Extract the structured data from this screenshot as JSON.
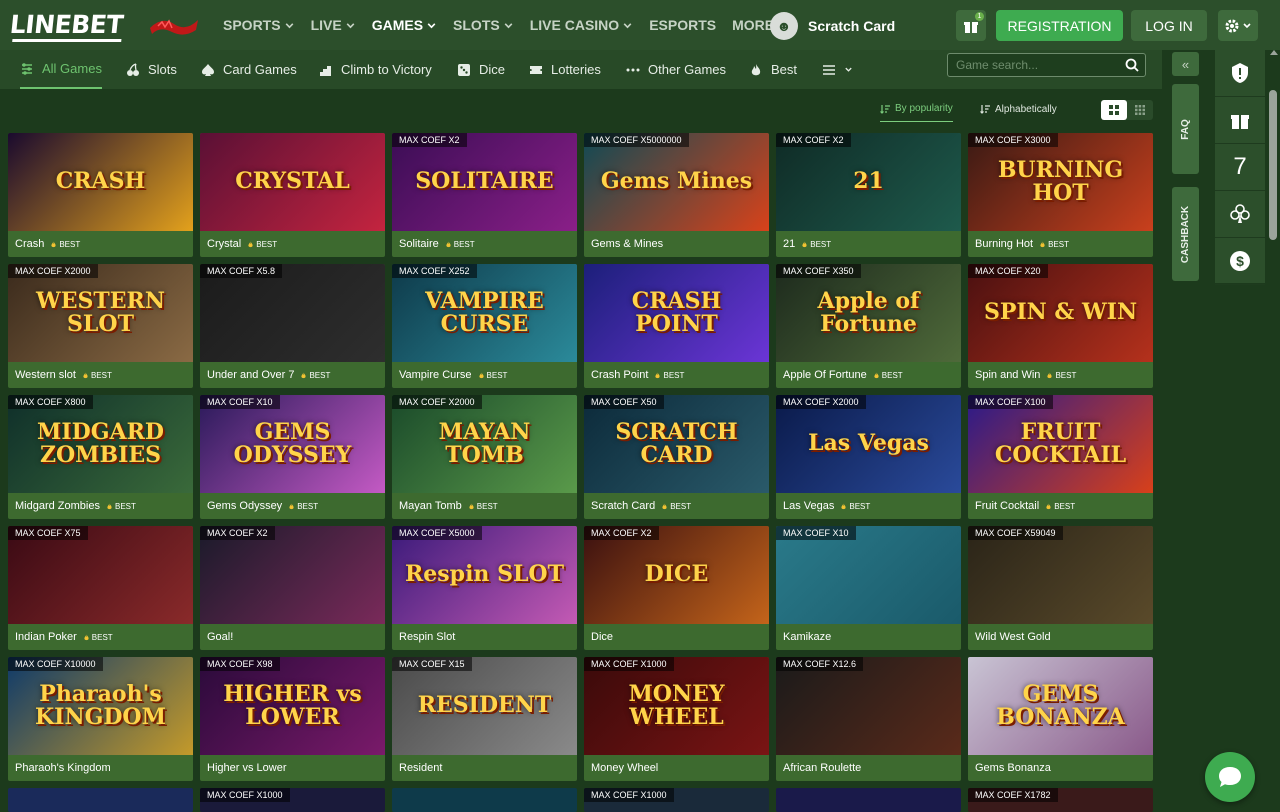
{
  "logo": "LINEBET",
  "nav": [
    {
      "label": "SPORTS",
      "chevron": true,
      "active": false
    },
    {
      "label": "LIVE",
      "chevron": true,
      "active": false
    },
    {
      "label": "GAMES",
      "chevron": true,
      "active": true
    },
    {
      "label": "SLOTS",
      "chevron": true,
      "active": false
    },
    {
      "label": "LIVE CASINO",
      "chevron": true,
      "active": false
    },
    {
      "label": "ESPORTS",
      "chevron": false,
      "active": false
    },
    {
      "label": "MORE",
      "chevron": true,
      "active": false
    }
  ],
  "scratch_card": "Scratch Card",
  "gift_badge": "1",
  "registration": "REGISTRATION",
  "login": "LOG IN",
  "categories": [
    {
      "label": "All Games",
      "icon": "sliders-icon",
      "active": true
    },
    {
      "label": "Slots",
      "icon": "cherries-icon",
      "active": false
    },
    {
      "label": "Card Games",
      "icon": "spade-icon",
      "active": false
    },
    {
      "label": "Climb to Victory",
      "icon": "chart-steps-icon",
      "active": false
    },
    {
      "label": "Dice",
      "icon": "dice-icon",
      "active": false
    },
    {
      "label": "Lotteries",
      "icon": "ticket-icon",
      "active": false
    },
    {
      "label": "Other Games",
      "icon": "dots-icon",
      "active": false
    },
    {
      "label": "Best",
      "icon": "flame-icon",
      "active": false
    }
  ],
  "search_placeholder": "Game search...",
  "sort": {
    "popularity": "By popularity",
    "alphabetical": "Alphabetically"
  },
  "side_tabs": {
    "faq": "FAQ",
    "cashback": "CASHBACK"
  },
  "side_number": "7",
  "best_label": "BEST",
  "games": [
    {
      "name": "Crash",
      "badge": "",
      "best": true,
      "art": "CRASH",
      "bg": [
        "#1a0a2e",
        "#e3a11c"
      ]
    },
    {
      "name": "Crystal",
      "badge": "",
      "best": true,
      "art": "CRYSTAL",
      "bg": [
        "#5a1035",
        "#c4243f"
      ]
    },
    {
      "name": "Solitaire",
      "badge": "MAX COEF X2",
      "best": true,
      "art": "SOLITAIRE",
      "bg": [
        "#3b0d55",
        "#8a1f88"
      ]
    },
    {
      "name": "Gems & Mines",
      "badge": "MAX COEF X5000000",
      "best": false,
      "art": "Gems Mines",
      "bg": [
        "#0f4a55",
        "#d8421a"
      ]
    },
    {
      "name": "21",
      "badge": "MAX COEF X2",
      "best": true,
      "art": "21",
      "bg": [
        "#0f2b26",
        "#1e5a4c"
      ]
    },
    {
      "name": "Burning Hot",
      "badge": "MAX COEF X3000",
      "best": true,
      "art": "BURNING HOT",
      "bg": [
        "#3a1a14",
        "#c9401d"
      ]
    },
    {
      "name": "Western slot",
      "badge": "MAX COEF X2000",
      "best": true,
      "art": "WESTERN SLOT",
      "bg": [
        "#3a2a1c",
        "#8a6a44"
      ]
    },
    {
      "name": "Under and Over 7",
      "badge": "MAX COEF X5.8",
      "best": true,
      "art": "",
      "bg": [
        "#1b1b1b",
        "#2e2e2e"
      ]
    },
    {
      "name": "Vampire Curse",
      "badge": "MAX COEF X252",
      "best": true,
      "art": "VAMPIRE CURSE",
      "bg": [
        "#0e3a4a",
        "#2b8a9a"
      ]
    },
    {
      "name": "Crash Point",
      "badge": "",
      "best": true,
      "art": "CRASH POINT",
      "bg": [
        "#1c1f7a",
        "#6b35d6"
      ]
    },
    {
      "name": "Apple Of Fortune",
      "badge": "MAX COEF X350",
      "best": true,
      "art": "Apple of Fortune",
      "bg": [
        "#1d2a1d",
        "#4f6a3a"
      ]
    },
    {
      "name": "Spin and Win",
      "badge": "MAX COEF X20",
      "best": true,
      "art": "SPIN & WIN",
      "bg": [
        "#4a1010",
        "#b5311c"
      ]
    },
    {
      "name": "Midgard Zombies",
      "badge": "MAX COEF X800",
      "best": true,
      "art": "MIDGARD ZOMBIES",
      "bg": [
        "#0f2f2a",
        "#3a6a3a"
      ]
    },
    {
      "name": "Gems Odyssey",
      "badge": "MAX COEF X10",
      "best": true,
      "art": "GEMS ODYSSEY",
      "bg": [
        "#2a1a5a",
        "#c45ac4"
      ]
    },
    {
      "name": "Mayan Tomb",
      "badge": "MAX COEF X2000",
      "best": true,
      "art": "MAYAN TOMB",
      "bg": [
        "#1a4a2a",
        "#5a9a4a"
      ]
    },
    {
      "name": "Scratch Card",
      "badge": "MAX COEF X50",
      "best": true,
      "art": "SCRATCH CARD",
      "bg": [
        "#0c2a3a",
        "#2a5a6a"
      ]
    },
    {
      "name": "Las Vegas",
      "badge": "MAX COEF X2000",
      "best": true,
      "art": "Las Vegas",
      "bg": [
        "#0a1a4a",
        "#2a4a9a"
      ]
    },
    {
      "name": "Fruit Cocktail",
      "badge": "MAX COEF X100",
      "best": true,
      "art": "FRUIT COCKTAIL",
      "bg": [
        "#2a1a8a",
        "#d8401a"
      ]
    },
    {
      "name": "Indian Poker",
      "badge": "MAX COEF X75",
      "best": true,
      "art": "",
      "bg": [
        "#3a0a14",
        "#8a2a2a"
      ]
    },
    {
      "name": "Goal!",
      "badge": "MAX COEF X2",
      "best": false,
      "art": "",
      "bg": [
        "#1a1a2a",
        "#7a2a5a"
      ]
    },
    {
      "name": "Respin Slot",
      "badge": "MAX COEF X5000",
      "best": false,
      "art": "Respin SLOT",
      "bg": [
        "#3a1a7a",
        "#c45ab4"
      ]
    },
    {
      "name": "Dice",
      "badge": "MAX COEF X2",
      "best": false,
      "art": "DICE",
      "bg": [
        "#3a1010",
        "#c4641a"
      ]
    },
    {
      "name": "Kamikaze",
      "badge": "MAX COEF X10",
      "best": false,
      "art": "",
      "bg": [
        "#2a7a8a",
        "#1a5a6a"
      ]
    },
    {
      "name": "Wild West Gold",
      "badge": "MAX COEF X59049",
      "best": false,
      "art": "",
      "bg": [
        "#2a2418",
        "#5a4a2a"
      ]
    },
    {
      "name": "Pharaoh's Kingdom",
      "badge": "MAX COEF X10000",
      "best": false,
      "art": "Pharaoh's KINGDOM",
      "bg": [
        "#0e3a6a",
        "#c49a2a"
      ]
    },
    {
      "name": "Higher vs Lower",
      "badge": "MAX COEF X98",
      "best": false,
      "art": "HIGHER vs LOWER",
      "bg": [
        "#2a0a3a",
        "#7a1a6a"
      ]
    },
    {
      "name": "Resident",
      "badge": "MAX COEF X15",
      "best": false,
      "art": "RESIDENT",
      "bg": [
        "#4a4a4a",
        "#8a8a8a"
      ]
    },
    {
      "name": "Money Wheel",
      "badge": "MAX COEF X1000",
      "best": false,
      "art": "MONEY WHEEL",
      "bg": [
        "#3a0a0a",
        "#7a1414"
      ]
    },
    {
      "name": "African Roulette",
      "badge": "MAX COEF X12.6",
      "best": false,
      "art": "",
      "bg": [
        "#1a1a1a",
        "#5a2a1a"
      ]
    },
    {
      "name": "Gems Bonanza",
      "badge": "",
      "best": false,
      "art": "GEMS BONANZA",
      "bg": [
        "#c9c4d4",
        "#8a5a8a"
      ]
    }
  ],
  "partial_row": [
    {
      "badge": "",
      "bg": "#1a2a5a"
    },
    {
      "badge": "MAX COEF X1000",
      "bg": "#1a1a3a"
    },
    {
      "badge": "",
      "bg": "#0e3a4a"
    },
    {
      "badge": "MAX COEF X1000",
      "bg": "#1a2a3a"
    },
    {
      "badge": "",
      "bg": "#1a1a4a"
    },
    {
      "badge": "MAX COEF X1782",
      "bg": "#3a1a1a"
    }
  ],
  "colors": {
    "topbar": "#2c4f2b",
    "page": "#1c3a1c",
    "card_footer": "#3d6a2f",
    "accent": "#3eab50",
    "active_tab": "#6ec36f"
  }
}
